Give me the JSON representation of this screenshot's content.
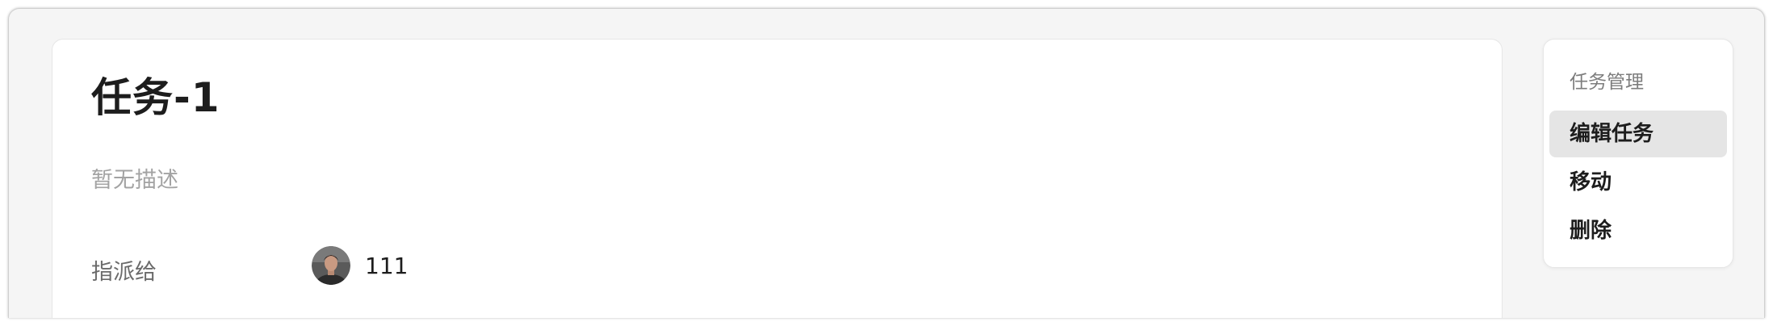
{
  "task": {
    "title": "任务-1",
    "description": "暂无描述",
    "assignee_label": "指派给",
    "assignee_name": "111"
  },
  "side_menu": {
    "heading": "任务管理",
    "items": [
      {
        "label": "编辑任务",
        "active": true
      },
      {
        "label": "移动",
        "active": false
      },
      {
        "label": "删除",
        "active": false
      }
    ]
  },
  "colors": {
    "page_bg": "#f5f5f5",
    "card_bg": "#ffffff",
    "title_text": "#1d1d1d",
    "muted_text": "#a3a3a3",
    "label_text": "#6b6b6b",
    "active_item_bg": "#e5e5e5"
  },
  "icons": {
    "assignee_avatar": "user-avatar"
  }
}
